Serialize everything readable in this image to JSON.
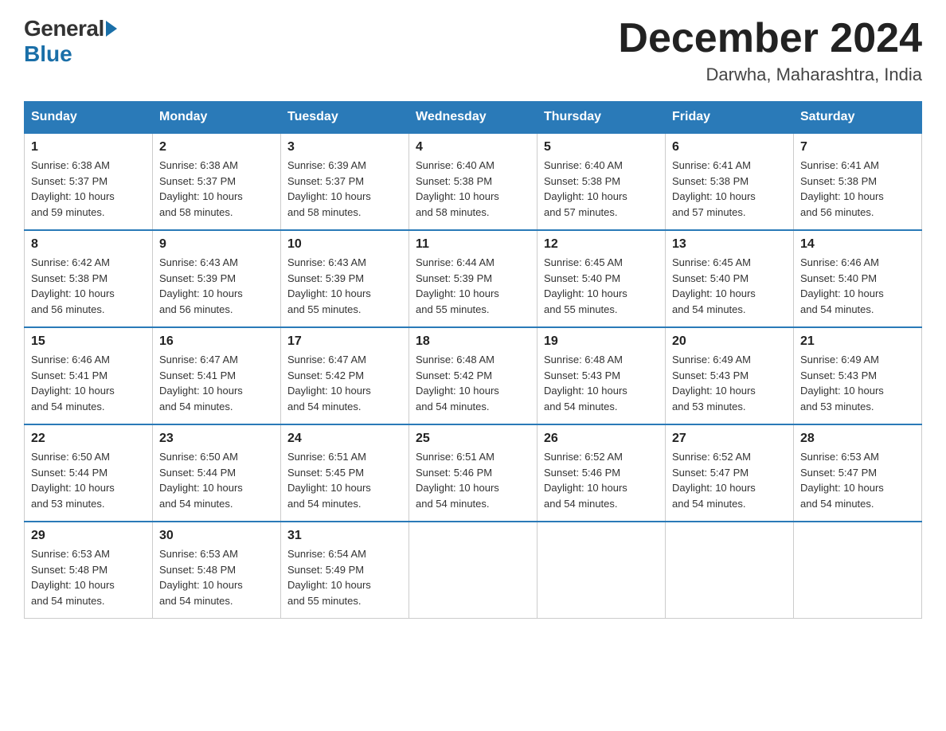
{
  "logo": {
    "general": "General",
    "blue": "Blue"
  },
  "title": "December 2024",
  "location": "Darwha, Maharashtra, India",
  "headers": [
    "Sunday",
    "Monday",
    "Tuesday",
    "Wednesday",
    "Thursday",
    "Friday",
    "Saturday"
  ],
  "weeks": [
    [
      {
        "day": "1",
        "sunrise": "6:38 AM",
        "sunset": "5:37 PM",
        "daylight": "10 hours and 59 minutes."
      },
      {
        "day": "2",
        "sunrise": "6:38 AM",
        "sunset": "5:37 PM",
        "daylight": "10 hours and 58 minutes."
      },
      {
        "day": "3",
        "sunrise": "6:39 AM",
        "sunset": "5:37 PM",
        "daylight": "10 hours and 58 minutes."
      },
      {
        "day": "4",
        "sunrise": "6:40 AM",
        "sunset": "5:38 PM",
        "daylight": "10 hours and 58 minutes."
      },
      {
        "day": "5",
        "sunrise": "6:40 AM",
        "sunset": "5:38 PM",
        "daylight": "10 hours and 57 minutes."
      },
      {
        "day": "6",
        "sunrise": "6:41 AM",
        "sunset": "5:38 PM",
        "daylight": "10 hours and 57 minutes."
      },
      {
        "day": "7",
        "sunrise": "6:41 AM",
        "sunset": "5:38 PM",
        "daylight": "10 hours and 56 minutes."
      }
    ],
    [
      {
        "day": "8",
        "sunrise": "6:42 AM",
        "sunset": "5:38 PM",
        "daylight": "10 hours and 56 minutes."
      },
      {
        "day": "9",
        "sunrise": "6:43 AM",
        "sunset": "5:39 PM",
        "daylight": "10 hours and 56 minutes."
      },
      {
        "day": "10",
        "sunrise": "6:43 AM",
        "sunset": "5:39 PM",
        "daylight": "10 hours and 55 minutes."
      },
      {
        "day": "11",
        "sunrise": "6:44 AM",
        "sunset": "5:39 PM",
        "daylight": "10 hours and 55 minutes."
      },
      {
        "day": "12",
        "sunrise": "6:45 AM",
        "sunset": "5:40 PM",
        "daylight": "10 hours and 55 minutes."
      },
      {
        "day": "13",
        "sunrise": "6:45 AM",
        "sunset": "5:40 PM",
        "daylight": "10 hours and 54 minutes."
      },
      {
        "day": "14",
        "sunrise": "6:46 AM",
        "sunset": "5:40 PM",
        "daylight": "10 hours and 54 minutes."
      }
    ],
    [
      {
        "day": "15",
        "sunrise": "6:46 AM",
        "sunset": "5:41 PM",
        "daylight": "10 hours and 54 minutes."
      },
      {
        "day": "16",
        "sunrise": "6:47 AM",
        "sunset": "5:41 PM",
        "daylight": "10 hours and 54 minutes."
      },
      {
        "day": "17",
        "sunrise": "6:47 AM",
        "sunset": "5:42 PM",
        "daylight": "10 hours and 54 minutes."
      },
      {
        "day": "18",
        "sunrise": "6:48 AM",
        "sunset": "5:42 PM",
        "daylight": "10 hours and 54 minutes."
      },
      {
        "day": "19",
        "sunrise": "6:48 AM",
        "sunset": "5:43 PM",
        "daylight": "10 hours and 54 minutes."
      },
      {
        "day": "20",
        "sunrise": "6:49 AM",
        "sunset": "5:43 PM",
        "daylight": "10 hours and 53 minutes."
      },
      {
        "day": "21",
        "sunrise": "6:49 AM",
        "sunset": "5:43 PM",
        "daylight": "10 hours and 53 minutes."
      }
    ],
    [
      {
        "day": "22",
        "sunrise": "6:50 AM",
        "sunset": "5:44 PM",
        "daylight": "10 hours and 53 minutes."
      },
      {
        "day": "23",
        "sunrise": "6:50 AM",
        "sunset": "5:44 PM",
        "daylight": "10 hours and 54 minutes."
      },
      {
        "day": "24",
        "sunrise": "6:51 AM",
        "sunset": "5:45 PM",
        "daylight": "10 hours and 54 minutes."
      },
      {
        "day": "25",
        "sunrise": "6:51 AM",
        "sunset": "5:46 PM",
        "daylight": "10 hours and 54 minutes."
      },
      {
        "day": "26",
        "sunrise": "6:52 AM",
        "sunset": "5:46 PM",
        "daylight": "10 hours and 54 minutes."
      },
      {
        "day": "27",
        "sunrise": "6:52 AM",
        "sunset": "5:47 PM",
        "daylight": "10 hours and 54 minutes."
      },
      {
        "day": "28",
        "sunrise": "6:53 AM",
        "sunset": "5:47 PM",
        "daylight": "10 hours and 54 minutes."
      }
    ],
    [
      {
        "day": "29",
        "sunrise": "6:53 AM",
        "sunset": "5:48 PM",
        "daylight": "10 hours and 54 minutes."
      },
      {
        "day": "30",
        "sunrise": "6:53 AM",
        "sunset": "5:48 PM",
        "daylight": "10 hours and 54 minutes."
      },
      {
        "day": "31",
        "sunrise": "6:54 AM",
        "sunset": "5:49 PM",
        "daylight": "10 hours and 55 minutes."
      },
      null,
      null,
      null,
      null
    ]
  ],
  "labels": {
    "sunrise": "Sunrise:",
    "sunset": "Sunset:",
    "daylight": "Daylight:"
  }
}
